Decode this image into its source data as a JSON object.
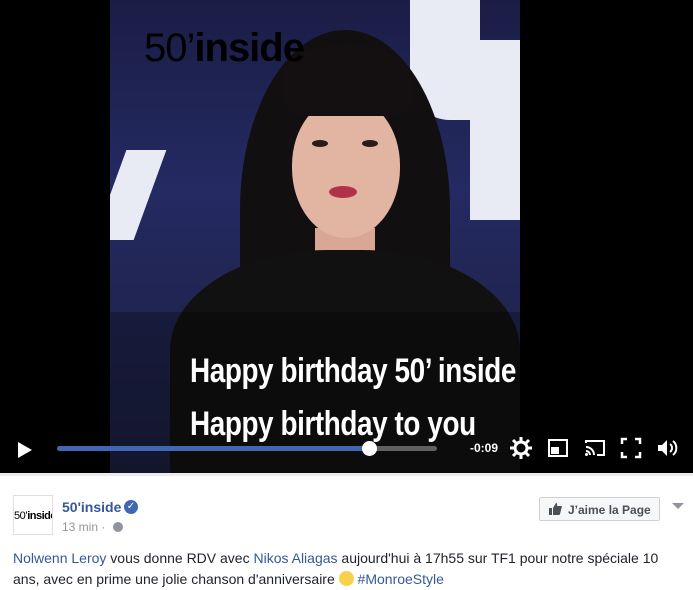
{
  "video": {
    "logo_number": "50’",
    "logo_word": "inside",
    "subtitle_line1": "Happy birthday 50’ inside",
    "subtitle_line2": "Happy birthday to you",
    "time_remaining": "-0:09",
    "progress_fraction": 0.82
  },
  "post": {
    "avatar_number": "50’",
    "avatar_word": "inside",
    "page_name": "50'inside",
    "timestamp": "13 min",
    "separator": "·",
    "like_button_label": "J’aime la Page",
    "text": {
      "link1": "Nolwenn Leroy",
      "part1": " vous donne RDV avec ",
      "link2": "Nikos Aliagas",
      "part2": " aujourd'hui à 17h55 sur TF1 pour notre spéciale 10 ans, avec en prime une jolie chanson d'anniversaire ",
      "hashtag": "#MonroeStyle"
    }
  },
  "icons": {
    "play": "play-icon",
    "settings": "gear-icon",
    "pip": "picture-in-picture-icon",
    "cast": "cast-icon",
    "fullscreen": "fullscreen-icon",
    "volume": "volume-icon",
    "verified": "verified-badge-icon",
    "audience": "globe-icon",
    "like": "thumbs-up-icon",
    "menu": "chevron-down-icon"
  },
  "colors": {
    "brand_blue": "#4267b2",
    "link_blue": "#365899"
  }
}
